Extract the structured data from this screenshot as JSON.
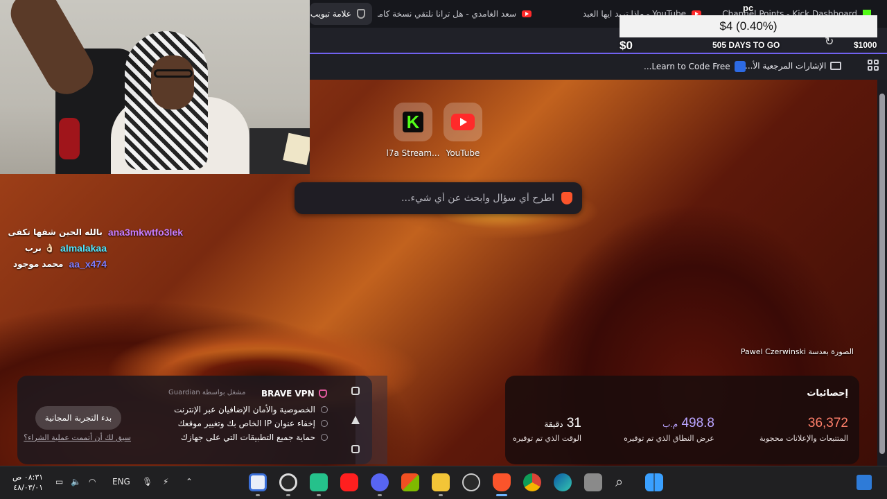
{
  "browser": {
    "tabs": [
      {
        "label": "علامة تبويب",
        "icon": "shield-icon",
        "active": true
      },
      {
        "label": "سعد الغامدي - هل ترانا نلتقي نسخة كاملة",
        "icon": "youtube-icon"
      },
      {
        "label": "YouTube - ماذا تريد ايها العبد",
        "icon": "youtube-icon"
      },
      {
        "label": "Channel Points - Kick Dashboard",
        "icon": "kick-icon"
      }
    ],
    "bookmarks": [
      {
        "label": "Learn to Code Free..."
      },
      {
        "label": "الإشارات المرجعية الأ..."
      }
    ]
  },
  "donation": {
    "amount": "$4 (0.40%)",
    "min": "$0",
    "max": "$1000",
    "countdown": "505 DAYS TO GO",
    "tag": "pc"
  },
  "shortcuts": [
    {
      "label": "l7a Stream...",
      "icon": "kick-icon"
    },
    {
      "label": "YouTube",
      "icon": "youtube-icon"
    }
  ],
  "search": {
    "placeholder": "اطرح أي سؤال وابحث عن أي شيء..."
  },
  "photo_credit": "الصورة بعدسة Pawel Czerwinski",
  "vpn": {
    "title": "BRAVE VPN",
    "guardian": "مشغل بواسطة Guardian",
    "features": [
      "الخصوصية والأمان الإضافيان عبر الإنترنت",
      "إخفاء عنوان IP الخاص بك وتغيير موقعك",
      "حماية جميع التطبيقات التي على جهازك"
    ],
    "trial_button": "بدء التجربة المجانية",
    "already_link": "سبق لك أن أتممت عملية الشراء؟"
  },
  "stats": {
    "title": "إحصائيات",
    "items": [
      {
        "value": "36,372",
        "label": "المتتبعات والإعلانات محجوبة",
        "color": "#ff7f6a"
      },
      {
        "value": "498.8",
        "unit": "م.ب",
        "label": "عرض النطاق الذي تم توفيره",
        "color": "#b9a4ff"
      },
      {
        "value": "31",
        "unit": "دقيقة",
        "label": "الوقت الذي تم توفيره",
        "color": "#ffffff"
      }
    ]
  },
  "chat": [
    {
      "user": "ana3mkwtfo3lek",
      "message": "بالله الحين شفها تكفى",
      "color": "#c77dff"
    },
    {
      "user": "almalakaa",
      "message": "👌🏻 برب",
      "color": "#4ee6ff"
    },
    {
      "user": "aa_x474",
      "message": "محمد موجود",
      "color": "#7d7dff"
    }
  ],
  "taskbar": {
    "time": "٠٨:٣١ ص",
    "date": "٤٨/٠٣/٠١",
    "lang": "ENG"
  }
}
